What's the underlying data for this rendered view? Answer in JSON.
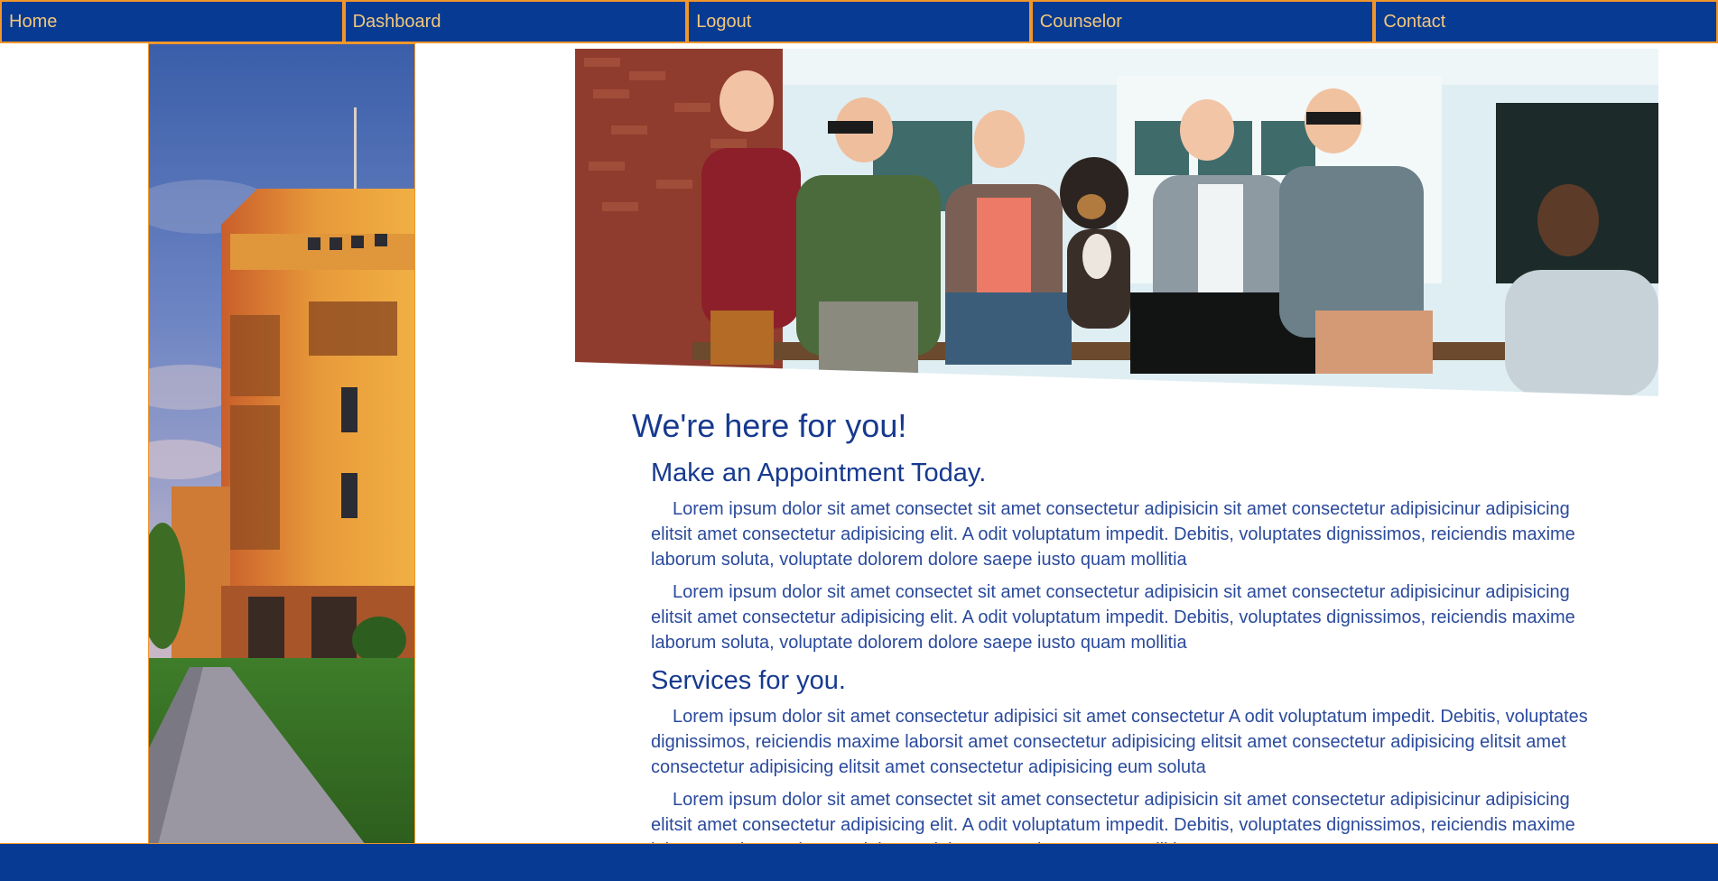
{
  "nav": {
    "items": [
      {
        "label": "Home"
      },
      {
        "label": "Dashboard"
      },
      {
        "label": "Logout"
      },
      {
        "label": "Counselor"
      },
      {
        "label": "Contact"
      }
    ]
  },
  "main": {
    "heading": "We're here for you!",
    "section1": {
      "title": "Make an Appointment Today.",
      "p1": "Lorem ipsum dolor sit amet consectet sit amet consectetur adipisicin sit amet consectetur adipisicinur adipisicing elitsit amet consectetur adipisicing elit. A odit voluptatum impedit. Debitis, voluptates dignissimos, reiciendis maxime laborum soluta, voluptate dolorem dolore saepe iusto quam mollitia",
      "p2": "Lorem ipsum dolor sit amet consectet sit amet consectetur adipisicin sit amet consectetur adipisicinur adipisicing elitsit amet consectetur adipisicing elit. A odit voluptatum impedit. Debitis, voluptates dignissimos, reiciendis maxime laborum soluta, voluptate dolorem dolore saepe iusto quam mollitia"
    },
    "section2": {
      "title": "Services for you.",
      "p1": "Lorem ipsum dolor sit amet consectetur adipisici sit amet consectetur A odit voluptatum impedit. Debitis, voluptates dignissimos, reiciendis maxime laborsit amet consectetur adipisicing elitsit amet consectetur adipisicing elitsit amet consectetur adipisicing elitsit amet consectetur adipisicing eum soluta",
      "p2": "Lorem ipsum dolor sit amet consectet sit amet consectetur adipisicin sit amet consectetur adipisicinur adipisicing elitsit amet consectetur adipisicing elit. A odit voluptatum impedit. Debitis, voluptates dignissimos, reiciendis maxime laborum soluta, voluptate dolorem dolore saepe iusto quam mollitia"
    }
  },
  "colors": {
    "brand_blue": "#073a93",
    "accent_orange": "#f0962a",
    "nav_text": "#f3c77a",
    "heading_text": "#173a8f"
  },
  "images": {
    "side_photo": "campus-building-icon",
    "banner_photo": "students-group-icon"
  }
}
